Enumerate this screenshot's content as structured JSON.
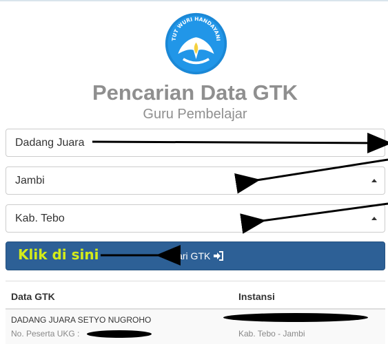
{
  "logo": {
    "motto": "TUT WURI HANDAYANI",
    "icon": "tut-wuri-handayani-emblem"
  },
  "header": {
    "title": "Pencarian Data GTK",
    "subtitle": "Guru Pembelajar"
  },
  "form": {
    "name_value": "Dadang Juara",
    "province_value": "Jambi",
    "district_value": "Kab. Tebo",
    "submit_label": "Cari GTK",
    "submit_icon": "sign-in-icon"
  },
  "annotation": {
    "click_here": "Klik di sini"
  },
  "table": {
    "headers": [
      "Data GTK",
      "Instansi"
    ],
    "rows": [
      {
        "name": "DADANG JUARA SETYO NUGROHO",
        "ukg_label": "No. Peserta UKG :",
        "location": "Kab. Tebo - Jambi"
      }
    ]
  },
  "colors": {
    "primary": "#2d6096",
    "title_gray": "#8f8f8f",
    "highlight": "#d4ec1a"
  }
}
